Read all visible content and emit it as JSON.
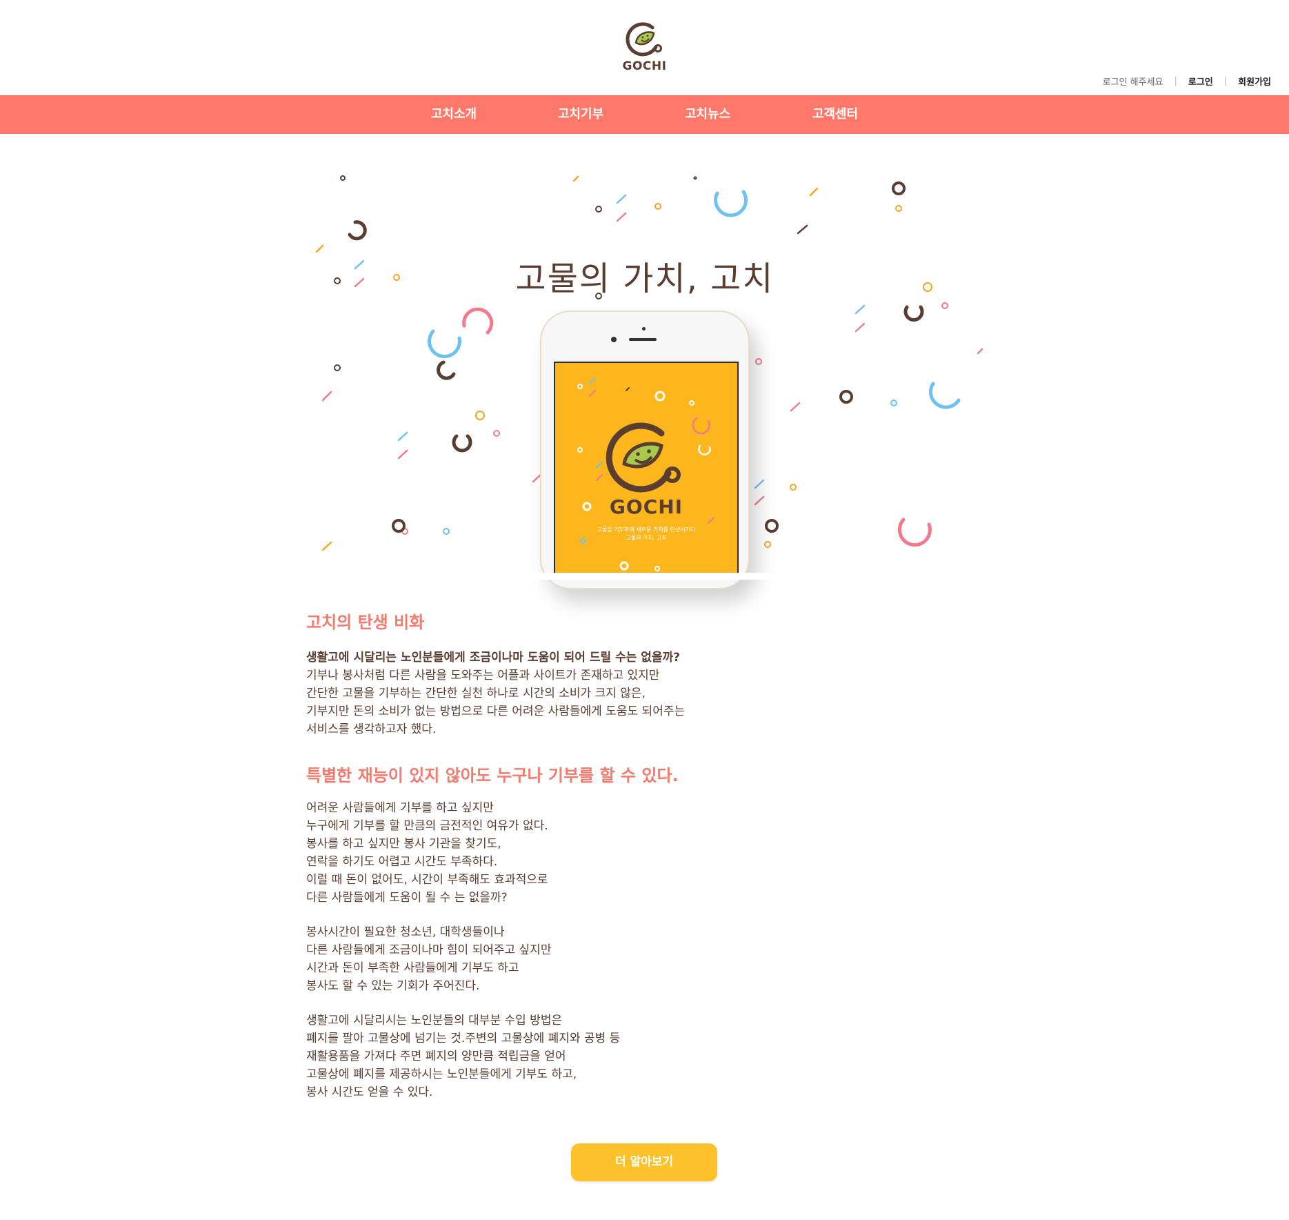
{
  "brand": {
    "name": "GOCHI"
  },
  "user_bar": {
    "message": "로그인 해주세요",
    "login": "로그인",
    "signup": "회원가입",
    "separator": "|"
  },
  "nav": {
    "items": [
      "고치소개",
      "고치기부",
      "고치뉴스",
      "고객센터"
    ]
  },
  "hero": {
    "title": "고물의 가치, 고치",
    "app_brand": "GOCHI",
    "app_tagline_1": "고물을 기부하여 새로운 가치를 탄생시키다",
    "app_tagline_2": "고물의 가치, 고치"
  },
  "sections": {
    "h1": "고치의 탄생 비화",
    "b1_strong": "생활고에 시달리는 노인분들에게 조금이나마 도움이 되어 드릴 수는 없을까?",
    "b1_lines": [
      "기부나 봉사처럼 다른 사람을 도와주는 어플과 사이트가 존재하고 있지만",
      "간단한 고물을 기부하는 간단한 실천 하나로 시간의 소비가 크지 않은,",
      "기부지만 돈의 소비가 없는 방법으로 다른 어려운 사람들에게 도움도 되어주는",
      "서비스를 생각하고자 했다."
    ],
    "h2": "특별한 재능이 있지 않아도 누구나 기부를 할 수 있다.",
    "b2_lines": [
      "어려운 사람들에게 기부를 하고 싶지만",
      "누구에게 기부를 할 만큼의 금전적인 여유가 없다.",
      "봉사를 하고 싶지만 봉사 기관을 찾기도,",
      "연락을 하기도 어렵고 시간도 부족하다.",
      "이럴 때 돈이 없어도, 시간이 부족해도 효과적으로",
      "다른 사람들에게 도움이 될 수 는 없을까?"
    ],
    "b3_lines": [
      "봉사시간이 필요한 청소년, 대학생들이나",
      "다른 사람들에게 조금이나마 힘이 되어주고 싶지만",
      "시간과 돈이 부족한 사람들에게 기부도 하고",
      "봉사도 할 수 있는 기회가 주어진다."
    ],
    "b4_lines": [
      "생활고에 시달리시는 노인분들의 대부분 수입 방법은",
      "폐지를 팔아 고물상에 넘기는 것.주변의 고물상에 폐지와 공병 등",
      "재활용품을 가져다 주면 폐지의 양만큼 적립금을 얻어",
      "고물상에 폐지를 제공하시는 노인분들에게 기부도 하고,",
      "봉사 시간도 얻을 수 있다."
    ]
  },
  "cta": {
    "label": "더 알아보기"
  },
  "colors": {
    "nav_bg": "#ff786a",
    "heading": "#f47a6e",
    "text_brown": "#5a3d31",
    "cta_bg": "#fdc22a",
    "app_screen": "#fdb71d",
    "leaf_green": "#a8c94a",
    "deco_blue": "#6ec1f0",
    "deco_pink": "#f27a8c",
    "deco_orange": "#f5a623"
  },
  "icons": {
    "logo": "gochi-leaf-logo",
    "decor": "confetti-rings"
  }
}
